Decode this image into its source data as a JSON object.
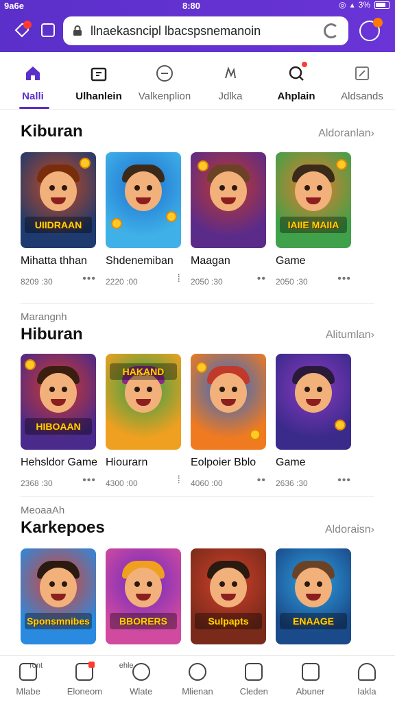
{
  "status_bar": {
    "carrier": "9a6e",
    "time": "8:80",
    "signal": "3%"
  },
  "browser": {
    "url": "llnaekasncipl lbacspsnemanoin",
    "lock_icon": "lock-icon",
    "reload_icon": "reload-icon",
    "notification_badge": "!"
  },
  "categories": [
    {
      "label": "Nalli",
      "icon": "home-icon",
      "active": true
    },
    {
      "label": "Ulhanlein",
      "icon": "gift-icon",
      "active": false
    },
    {
      "label": "Valkenplion",
      "icon": "dice-icon",
      "active": false
    },
    {
      "label": "Jdlka",
      "icon": "pawprint-icon",
      "active": false
    },
    {
      "label": "Ahplain",
      "icon": "search-icon",
      "active": false
    },
    {
      "label": "Aldsands",
      "icon": "edit-icon",
      "active": false
    }
  ],
  "sections": [
    {
      "subtitle": "",
      "title": "Kiburan",
      "more": "Aldoranlan›",
      "cards": [
        {
          "title": "Mihatta thhan",
          "meta": "8209 :30",
          "banner": "UIIDRAAN",
          "palette": [
            "#1e3a6e",
            "#c84a1e",
            "#7a2d0a"
          ]
        },
        {
          "title": "Shdenemiban",
          "meta": "2220 :00",
          "banner": "",
          "palette": [
            "#3fb1e8",
            "#1e6fd0",
            "#3b2a1a"
          ]
        },
        {
          "title": "Maagan",
          "meta": "2050 :30",
          "banner": "",
          "palette": [
            "#5b2b8a",
            "#c0392b",
            "#6b4226"
          ]
        },
        {
          "title": "Game",
          "meta": "2050 :30",
          "banner": "IAIIE MAIIA",
          "palette": [
            "#3fa14a",
            "#e87a2a",
            "#3a2a1a"
          ]
        }
      ]
    },
    {
      "subtitle": "Marangnh",
      "title": "Hiburan",
      "more": "Alitumlan›",
      "cards": [
        {
          "title": "Hehsldor Game",
          "meta": "2368 :30",
          "banner": "HIBOAAN",
          "palette": [
            "#4a2a8a",
            "#d4382a",
            "#3a1e10"
          ]
        },
        {
          "title": "Hiourarn",
          "meta": "4300 :00",
          "banner": "HAKAND",
          "palette": [
            "#f0a020",
            "#2ea04a",
            "#8a2a8a"
          ]
        },
        {
          "title": "Eolpoier Bblo",
          "meta": "4060 :00",
          "banner": "",
          "palette": [
            "#f07a20",
            "#2a6ad0",
            "#c0392b"
          ]
        },
        {
          "title": "Game",
          "meta": "2636 :30",
          "banner": "",
          "palette": [
            "#3a2a8a",
            "#8a3ac0",
            "#2a1a3a"
          ]
        }
      ]
    },
    {
      "subtitle": "MeoaaAh",
      "title": "Karkepoes",
      "more": "Aldoraisn›",
      "cards": [
        {
          "title": "",
          "meta": "",
          "banner": "Sponsmnibes",
          "palette": [
            "#2a8ae0",
            "#e0402a",
            "#2a1a10"
          ]
        },
        {
          "title": "",
          "meta": "",
          "banner": "BBORERS",
          "palette": [
            "#d04aa0",
            "#6a2ac0",
            "#f0a020"
          ]
        },
        {
          "title": "",
          "meta": "",
          "banner": "Sulpapts",
          "palette": [
            "#7a2a1a",
            "#d0402a",
            "#2a1a10"
          ]
        },
        {
          "title": "",
          "meta": "",
          "banner": "ENAAGE",
          "palette": [
            "#1a4a8a",
            "#2ea0e0",
            "#6b4226"
          ]
        }
      ]
    }
  ],
  "bottom_nav": [
    {
      "label": "Mlabe",
      "icon": "home-icon",
      "sub": "ront",
      "dot": false
    },
    {
      "label": "Eloneom",
      "icon": "document-icon",
      "sub": "",
      "dot": true
    },
    {
      "label": "Wlate",
      "icon": "refresh-icon",
      "sub": "ehle",
      "dot": false
    },
    {
      "label": "Mlienan",
      "icon": "flower-icon",
      "sub": "",
      "dot": false
    },
    {
      "label": "Cleden",
      "icon": "wallet-icon",
      "sub": "",
      "dot": false
    },
    {
      "label": "Abuner",
      "icon": "edit-icon",
      "sub": "",
      "dot": false
    },
    {
      "label": "Iakla",
      "icon": "user-icon",
      "sub": "",
      "dot": false
    }
  ]
}
